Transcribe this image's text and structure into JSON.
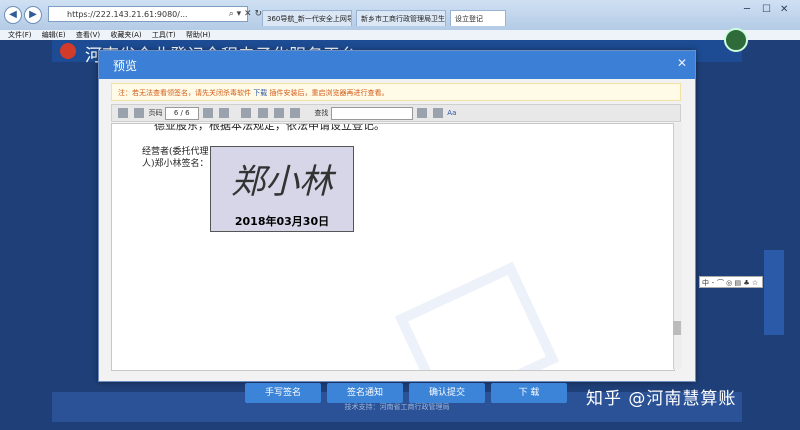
{
  "browser": {
    "address": "https://222.143.21.61:9080/...",
    "tabs": [
      {
        "label": "360导航_新一代安全上网导航"
      },
      {
        "label": "新乡市工商行政管理局卫生计..."
      },
      {
        "label": "设立登记"
      }
    ]
  },
  "menu": {
    "items": [
      "文件(F)",
      "编辑(E)",
      "查看(V)",
      "收藏夹(A)",
      "工具(T)",
      "帮助(H)"
    ]
  },
  "site": {
    "title": "河南省企业登记全程电子化服务平台"
  },
  "modal": {
    "title": "预览",
    "notice": "注：若无法查看领签名，请先关闭杀毒软件",
    "notice_link": "下载",
    "notice_tail": "插件安装后，重启浏览器再进行查看。",
    "toolbar": {
      "page_label": "页码",
      "page_value": "6 / 6",
      "find_label": "查找"
    },
    "document": {
      "top_text": "德亚股东，根据本法规定，依法申请设立登记。",
      "signer_label": "经营者(委托代理人)郑小林签名：",
      "signature_text": "郑小林",
      "signature_date": "2018年03月30日"
    },
    "buttons": {
      "handwrite": "手写签名",
      "notify": "签名通知",
      "confirm": "确认提交",
      "download": "下 载"
    }
  },
  "footer": {
    "text": "技术支持：河南省工商行政管理局"
  },
  "brand": {
    "text": "知乎 @河南慧算账"
  },
  "ime": {
    "text": "中 ･ ⌒ ◎ ▤ ♣ ☆"
  }
}
